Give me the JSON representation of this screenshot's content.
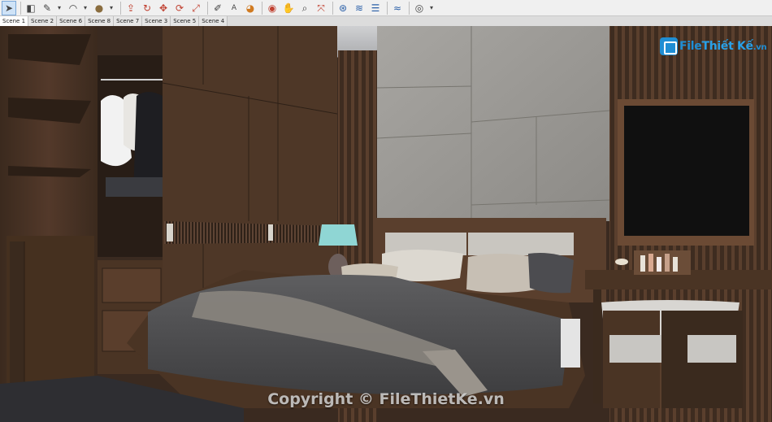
{
  "toolbar": {
    "tools": [
      {
        "icon": "select-arrow-icon",
        "glyph": "➤",
        "active": true
      },
      {
        "icon": "eraser-icon",
        "glyph": "◧"
      },
      {
        "icon": "pencil-line-icon",
        "glyph": "✎"
      },
      {
        "icon": "arc-icon",
        "glyph": "◠"
      },
      {
        "icon": "shape-circle-icon",
        "glyph": "●"
      },
      {
        "icon": "push-pull-icon",
        "glyph": "⇪"
      },
      {
        "icon": "follow-me-icon",
        "glyph": "↻"
      },
      {
        "icon": "move-icon",
        "glyph": "✥"
      },
      {
        "icon": "rotate-icon",
        "glyph": "⟳"
      },
      {
        "icon": "scale-icon",
        "glyph": "⤢"
      },
      {
        "icon": "tape-measure-icon",
        "glyph": "✐"
      },
      {
        "icon": "text-icon",
        "glyph": "A"
      },
      {
        "icon": "paint-bucket-icon",
        "glyph": "◕"
      },
      {
        "icon": "orbit-icon",
        "glyph": "◉"
      },
      {
        "icon": "pan-hand-icon",
        "glyph": "✋"
      },
      {
        "icon": "zoom-icon",
        "glyph": "⌕"
      },
      {
        "icon": "zoom-extents-icon",
        "glyph": "⤧"
      },
      {
        "icon": "warehouse-icon",
        "glyph": "⊛"
      },
      {
        "icon": "share-model-icon",
        "glyph": "≋"
      },
      {
        "icon": "components-icon",
        "glyph": "☰"
      },
      {
        "icon": "extension-icon",
        "glyph": "≈"
      },
      {
        "icon": "account-icon",
        "glyph": "◎"
      }
    ]
  },
  "scene_tabs": [
    {
      "label": "Scene 1",
      "active": true
    },
    {
      "label": "Scene 2"
    },
    {
      "label": "Scene 6"
    },
    {
      "label": "Scene 8"
    },
    {
      "label": "Scene 7"
    },
    {
      "label": "Scene 3"
    },
    {
      "label": "Scene 5"
    },
    {
      "label": "Scene 4"
    }
  ],
  "logo": {
    "part1": "File",
    "part2": "Thiết Kế",
    "part3": ".vn"
  },
  "watermark": "Copyright © FileThietKe.vn",
  "colors": {
    "wood_dark": "#3d2b1f",
    "wood_mid": "#5a4030",
    "panel_gray": "#9c9a96",
    "toolbar_bg": "#f0f0f0",
    "logo_blue": "#1f8ed4"
  }
}
